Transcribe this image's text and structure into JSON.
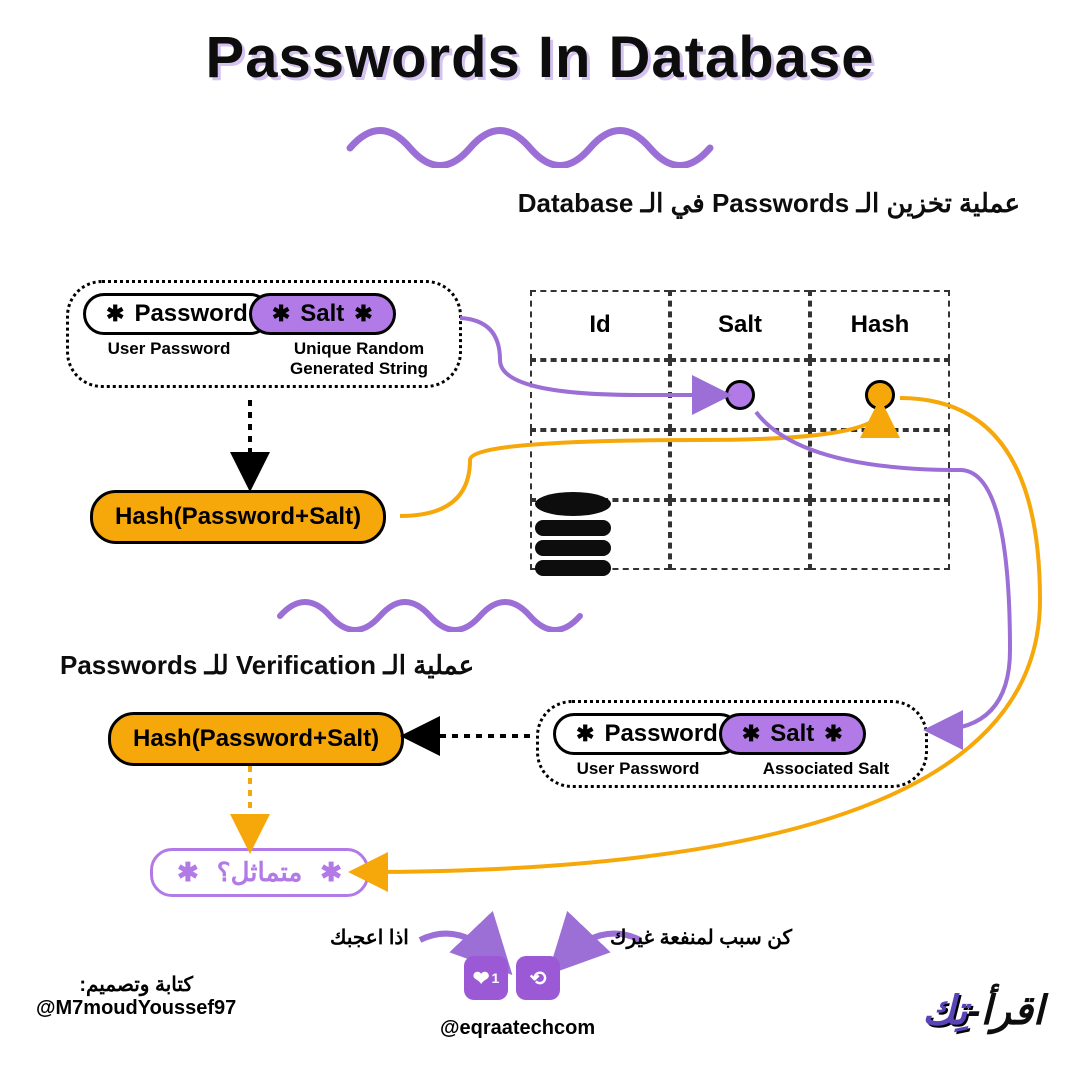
{
  "title": "Passwords In Database",
  "section1_heading": "عملية تخزين الـ Passwords في الـ Database",
  "section2_heading": "عملية الـ Verification للـ Passwords",
  "pill_password": "Password",
  "pill_salt": "Salt",
  "sub_user_password": "User Password",
  "sub_unique": "Unique Random Generated String",
  "sub_assoc_salt": "Associated Salt",
  "hash_label": "Hash(Password+Salt)",
  "table_headers": {
    "id": "Id",
    "salt": "Salt",
    "hash": "Hash"
  },
  "compare_label": "متماثل؟",
  "footer": {
    "author_line1": "كتابة وتصميم:",
    "author_line2": "@M7moudYoussef97",
    "handle": "@eqraatechcom",
    "left_note": "اذا اعجبك",
    "right_note": "كن سبب لمنفعة غيرك",
    "brand_a": "اقرأ-",
    "brand_b": "تِك",
    "like_count": "1"
  },
  "colors": {
    "purple": "#b27ae6",
    "orange": "#f6a80b",
    "dark_purple": "#5b43b8"
  }
}
